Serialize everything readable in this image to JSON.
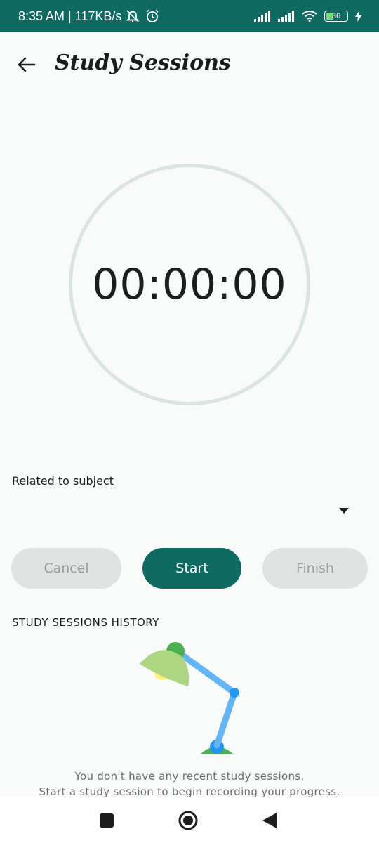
{
  "status_bar": {
    "time_and_speed": "8:35 AM | 117KB/s",
    "battery_level": "36"
  },
  "header": {
    "title": "Study Sessions"
  },
  "timer": {
    "display": "00:00:00"
  },
  "subject": {
    "label": "Related to subject",
    "selected_value": ""
  },
  "actions": {
    "cancel_label": "Cancel",
    "start_label": "Start",
    "finish_label": "Finish"
  },
  "history": {
    "header": "STUDY SESSIONS HISTORY",
    "empty_line1": "You don't have any recent study sessions.",
    "empty_line2": "Start a study session to begin recording your progress."
  },
  "colors": {
    "primary": "#0f6a62",
    "ring": "#d8e5e3",
    "disabled_bg": "#e1e3e2",
    "disabled_text": "#9a9c9b"
  },
  "icons": {
    "back": "arrow-left-icon",
    "dropdown": "caret-down-icon",
    "nav_recents": "square-icon",
    "nav_home": "circle-icon",
    "nav_back": "triangle-back-icon"
  }
}
